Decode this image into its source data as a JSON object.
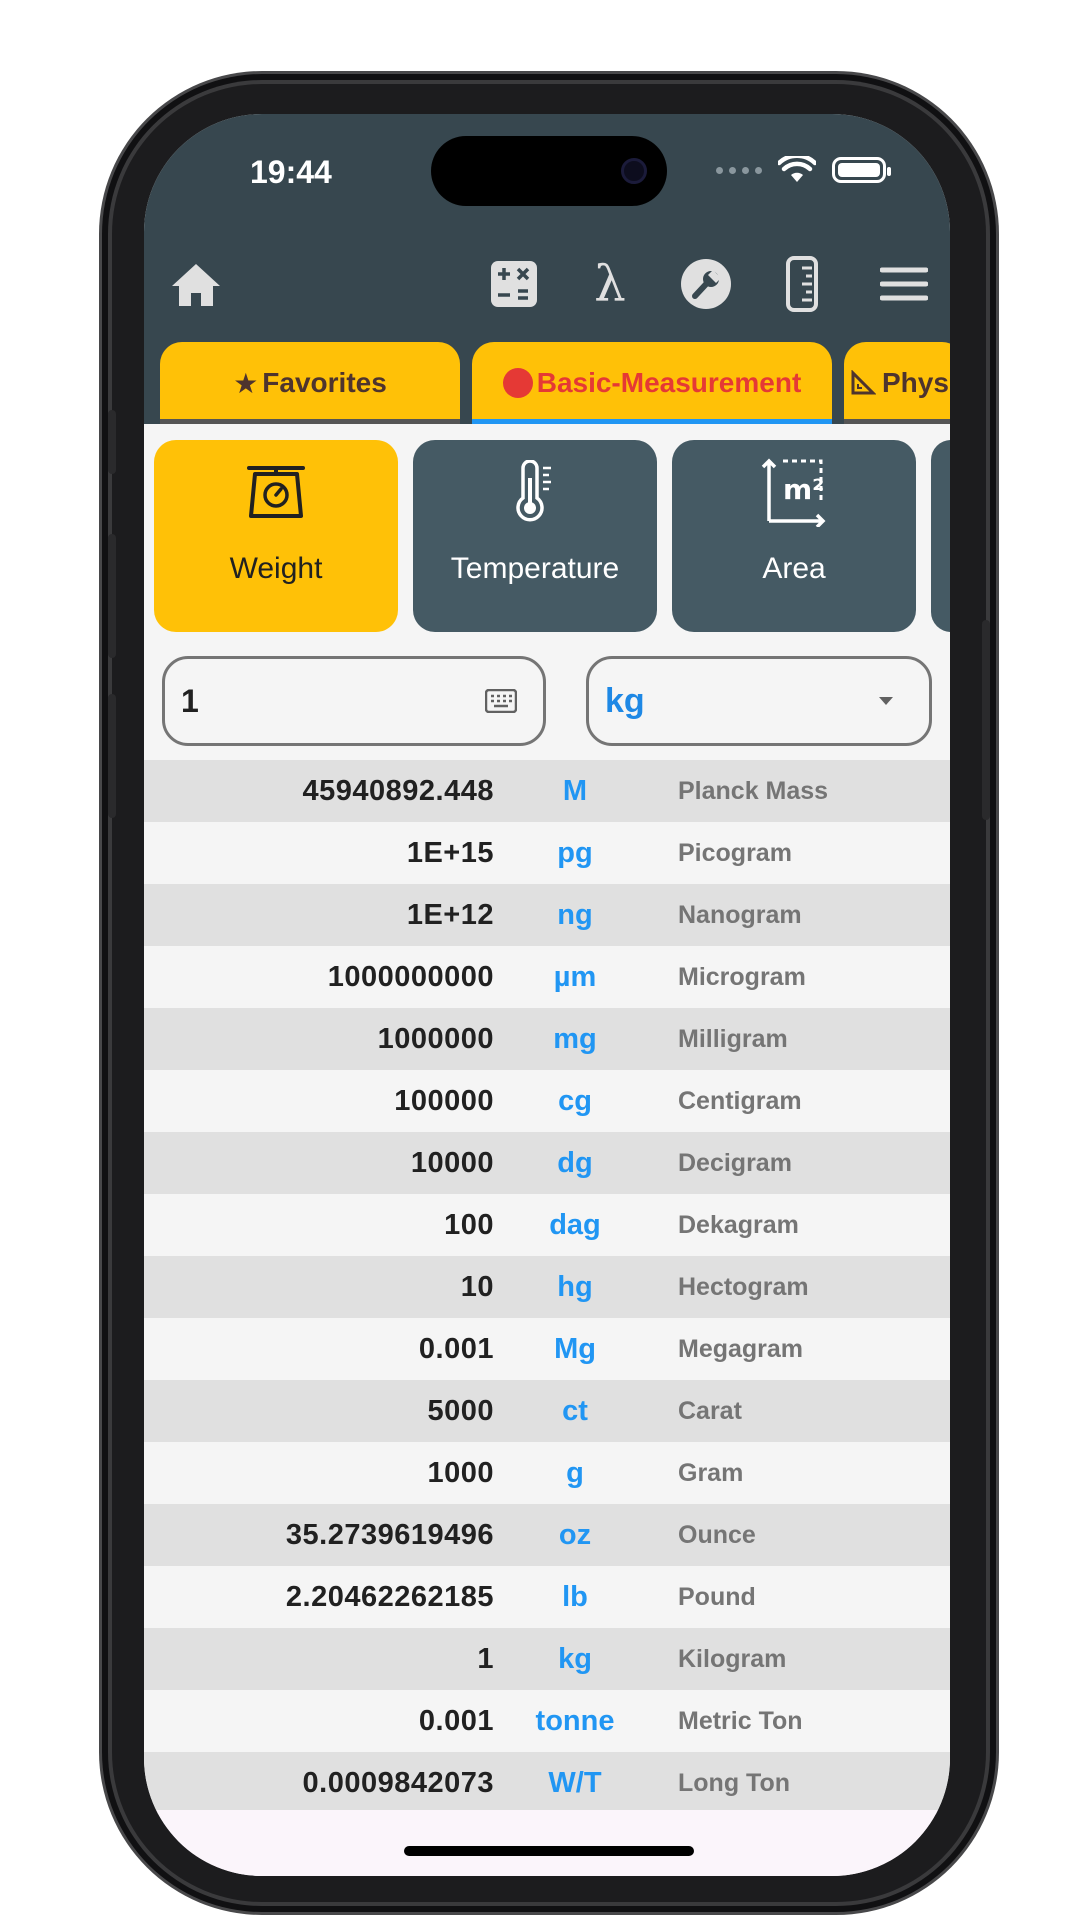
{
  "status_bar": {
    "time": "19:44"
  },
  "toolbar": {
    "home_icon": "home-icon",
    "calculator_icon": "calculator-icon",
    "lambda_symbol": "λ",
    "wrench_icon": "wrench-icon",
    "ruler_icon": "ruler-icon",
    "menu_icon": "menu-icon"
  },
  "tabs": [
    {
      "label": "Favorites",
      "prefix": "★",
      "active": false
    },
    {
      "label": "Basic-Measurement",
      "active": true
    },
    {
      "label": "Phys",
      "active": false
    }
  ],
  "categories": [
    {
      "label": "Weight",
      "icon": "scale-icon",
      "active": true
    },
    {
      "label": "Temperature",
      "icon": "thermometer-icon",
      "active": false
    },
    {
      "label": "Area",
      "icon": "area-icon",
      "icon_text": "m²",
      "active": false
    }
  ],
  "input": {
    "value": "1",
    "keyboard_icon": "keyboard-icon"
  },
  "unit_select": {
    "value": "kg",
    "dropdown_icon": "dropdown-arrow-icon"
  },
  "results": [
    {
      "value": "45940892.448",
      "unit": "M",
      "name": "Planck Mass"
    },
    {
      "value": "1E+15",
      "unit": "pg",
      "name": "Picogram"
    },
    {
      "value": "1E+12",
      "unit": "ng",
      "name": "Nanogram"
    },
    {
      "value": "1000000000",
      "unit": "µm",
      "name": "Microgram"
    },
    {
      "value": "1000000",
      "unit": "mg",
      "name": "Milligram"
    },
    {
      "value": "100000",
      "unit": "cg",
      "name": "Centigram"
    },
    {
      "value": "10000",
      "unit": "dg",
      "name": "Decigram"
    },
    {
      "value": "100",
      "unit": "dag",
      "name": "Dekagram"
    },
    {
      "value": "10",
      "unit": "hg",
      "name": "Hectogram"
    },
    {
      "value": "0.001",
      "unit": "Mg",
      "name": "Megagram"
    },
    {
      "value": "5000",
      "unit": "ct",
      "name": "Carat"
    },
    {
      "value": "1000",
      "unit": "g",
      "name": "Gram"
    },
    {
      "value": "35.2739619496",
      "unit": "oz",
      "name": "Ounce"
    },
    {
      "value": "2.20462262185",
      "unit": "lb",
      "name": "Pound"
    },
    {
      "value": "1",
      "unit": "kg",
      "name": "Kilogram"
    },
    {
      "value": "0.001",
      "unit": "tonne",
      "name": "Metric Ton"
    },
    {
      "value": "0.0009842073",
      "unit": "W/T",
      "name": "Long Ton"
    }
  ],
  "colors": {
    "app_bar": "#37474f",
    "accent_yellow": "#ffc107",
    "category_dark": "#455a64",
    "unit_blue": "#2196f3",
    "active_tab_text": "#e53935"
  }
}
